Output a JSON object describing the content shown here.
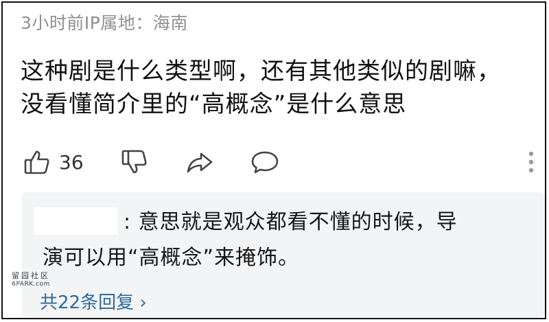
{
  "comment": {
    "meta": "3小时前IP属地：海南",
    "text_line1": "这种剧是什么类型啊，还有其他类似的剧嘛，",
    "text_line2": "没看懂简介里的“高概念”是什么意思"
  },
  "actions": {
    "like_count": "36",
    "icons": [
      "thumbs-up-icon",
      "thumbs-down-icon",
      "share-icon",
      "comment-icon",
      "more-vertical-icon"
    ]
  },
  "reply": {
    "text_line1": ": 意思就是观众都看不懂的时候，导",
    "text_line2": "演可以用“高概念”来掩饰。",
    "replies_link": "共22条回复 ›"
  },
  "watermark": {
    "line1": "留园社区",
    "line2": "6PARK.com"
  },
  "colors": {
    "meta_text": "#8f8f8f",
    "link": "#2f6b9a",
    "reply_bg": "#f3f4f6"
  }
}
